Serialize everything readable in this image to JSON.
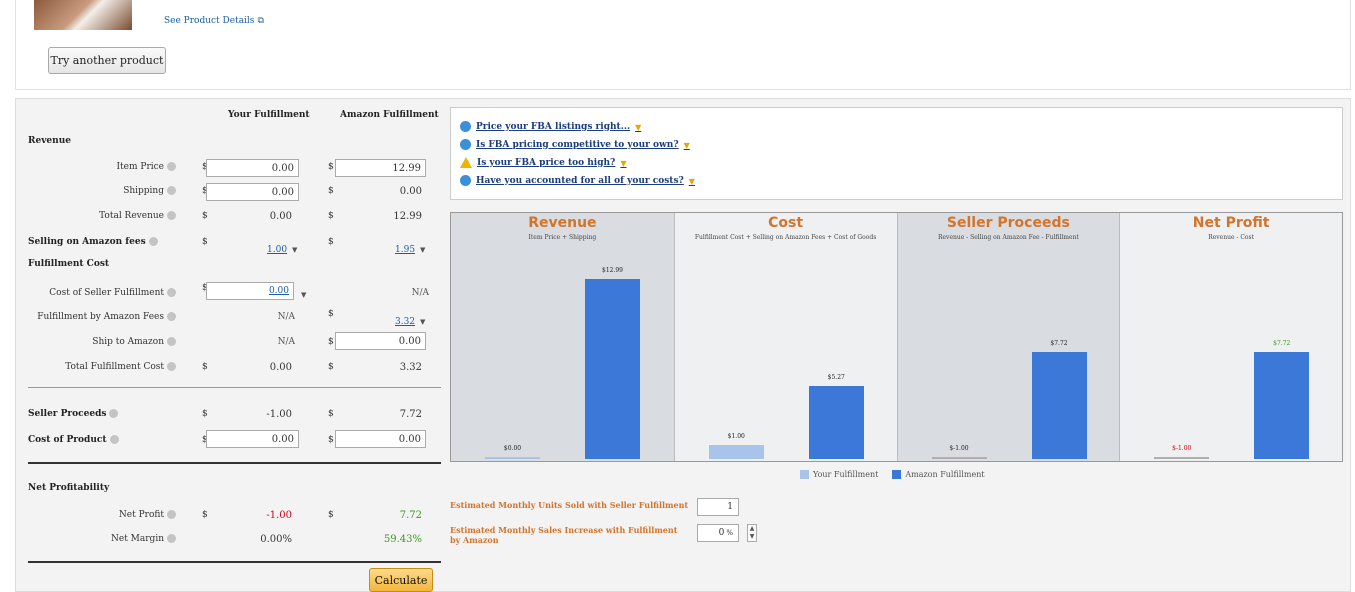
{
  "header": {
    "see_details": "See Product Details",
    "try_another": "Try another product"
  },
  "columns": {
    "your": "Your Fulfillment",
    "amazon": "Amazon Fulfillment"
  },
  "sections": {
    "revenue": "Revenue",
    "fulfillment": "Fulfillment Cost",
    "net": "Net Profitability"
  },
  "currency": "$",
  "rows": {
    "item_price": {
      "label": "Item Price",
      "your": "0.00",
      "amazon": "12.99"
    },
    "shipping": {
      "label": "Shipping",
      "your": "0.00",
      "amazon": "0.00"
    },
    "total_revenue": {
      "label": "Total Revenue",
      "your": "0.00",
      "amazon": "12.99"
    },
    "selling_fees": {
      "label": "Selling on Amazon fees",
      "your": "1.00",
      "amazon": "1.95"
    },
    "seller_fulfillment": {
      "label": "Cost of Seller Fulfillment",
      "your": "0.00",
      "amazon": "N/A"
    },
    "fba_fees": {
      "label": "Fulfillment by Amazon Fees",
      "your": "N/A",
      "amazon": "3.32"
    },
    "ship_to_amazon": {
      "label": "Ship to Amazon",
      "your": "N/A",
      "amazon": "0.00"
    },
    "total_fulfillment": {
      "label": "Total Fulfillment Cost",
      "your": "0.00",
      "amazon": "3.32"
    },
    "seller_proceeds": {
      "label": "Seller Proceeds",
      "your": "-1.00",
      "amazon": "7.72"
    },
    "cost_of_product": {
      "label": "Cost of Product",
      "your": "0.00",
      "amazon": "0.00"
    },
    "net_profit": {
      "label": "Net Profit",
      "your": "-1.00",
      "amazon": "7.72"
    },
    "net_margin": {
      "label": "Net Margin",
      "your": "0.00%",
      "amazon": "59.43%"
    }
  },
  "calculate": "Calculate",
  "tips": [
    "Price your FBA listings right...",
    "Is FBA pricing competitive to your own?",
    "Is your FBA price too high?",
    "Have you accounted for all of your costs?"
  ],
  "chart_data": {
    "type": "bar",
    "panels": [
      {
        "title": "Revenue",
        "subtitle": "Item Price + Shipping",
        "your": 0.0,
        "amazon": 12.99,
        "your_label": "$0.00",
        "amazon_label": "$12.99"
      },
      {
        "title": "Cost",
        "subtitle": "Fulfillment Cost + Selling on Amazon Fees + Cost of Goods",
        "your": 1.0,
        "amazon": 5.27,
        "your_label": "$1.00",
        "amazon_label": "$5.27"
      },
      {
        "title": "Seller Proceeds",
        "subtitle": "Revenue - Selling on Amazon Fee - Fulfillment",
        "your": -1.0,
        "amazon": 7.72,
        "your_label": "$-1.00",
        "amazon_label": "$7.72"
      },
      {
        "title": "Net Profit",
        "subtitle": "Revenue - Cost",
        "your": -1.0,
        "amazon": 7.72,
        "your_label": "$-1.00",
        "amazon_label": "$7.72"
      }
    ],
    "series": [
      {
        "name": "Your Fulfillment",
        "color": "#a9c4ea"
      },
      {
        "name": "Amazon Fulfillment",
        "color": "#3b78d8"
      }
    ],
    "ylim": [
      0,
      12.99
    ]
  },
  "estimates": {
    "units_label": "Estimated Monthly Units Sold with Seller Fulfillment",
    "units_value": "1",
    "increase_label": "Estimated Monthly Sales Increase with Fulfillment by Amazon",
    "increase_value": "0",
    "increase_unit": "%"
  }
}
